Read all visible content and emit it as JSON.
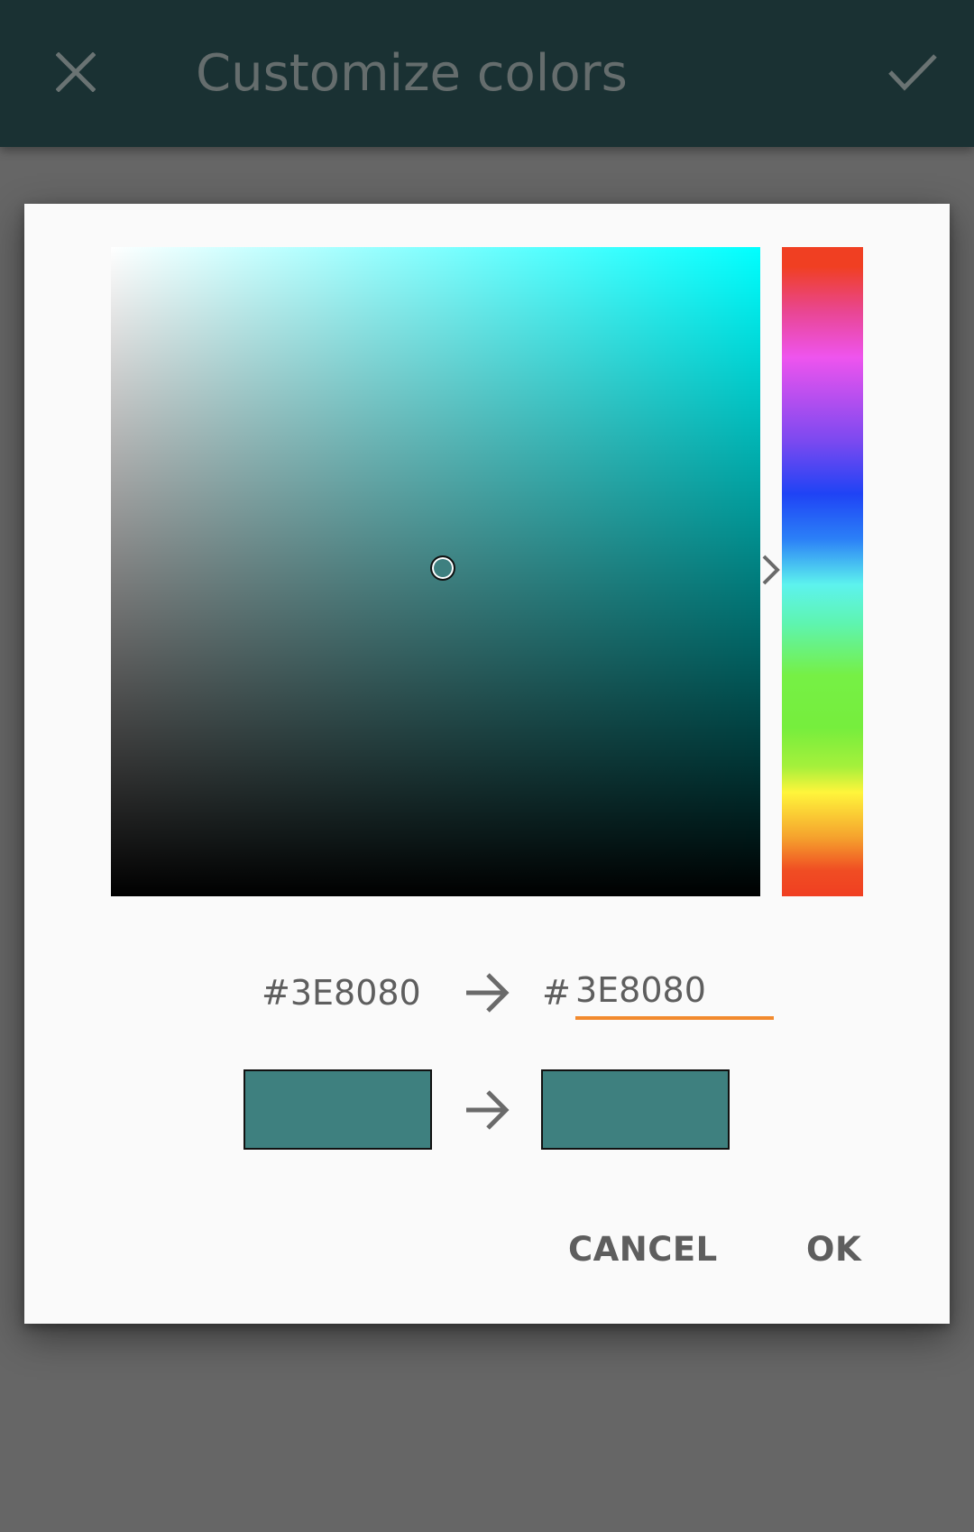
{
  "app_bar": {
    "title": "Customize colors",
    "close_icon": "close-icon",
    "confirm_icon": "check-icon",
    "background": "#1a3133"
  },
  "color_picker": {
    "hue_color": "#00ffff",
    "selected_color": "#3E8080",
    "hex_old": "#3E8080",
    "hash_symbol": "#",
    "hex_input_value": "3E8080",
    "old_swatch_color": "#3e807f",
    "new_swatch_color": "#3e807f",
    "arrow_icon": "arrow-right-icon",
    "hue_pointer_icon": "chevron-right-icon",
    "accent": "#f28a2e"
  },
  "buttons": {
    "cancel": "CANCEL",
    "ok": "OK"
  }
}
